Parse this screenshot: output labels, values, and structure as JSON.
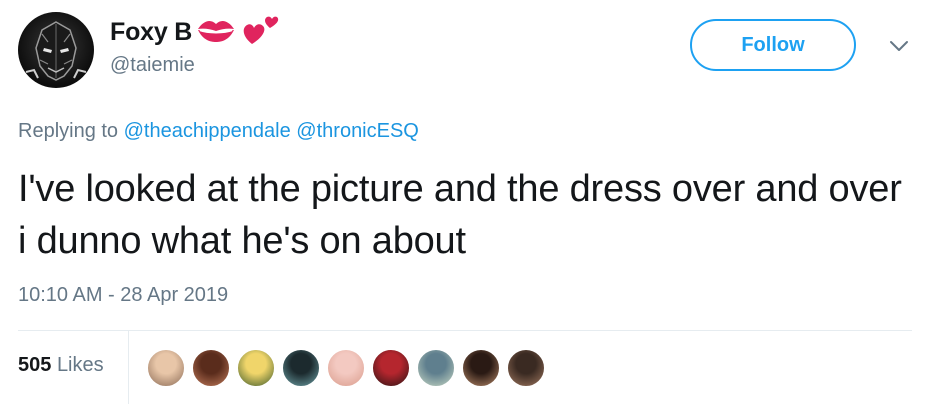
{
  "user": {
    "display_name": "Foxy B",
    "emoji_icons": [
      "kiss-mark-icon",
      "two-hearts-icon"
    ],
    "username": "@taiemie"
  },
  "follow_label": "Follow",
  "reply": {
    "prefix": "Replying to",
    "mentions": [
      "@theachippendale",
      "@thronicESQ"
    ]
  },
  "tweet_text": "I've looked at the picture and the dress over and over i dunno what he's on about",
  "timestamp": "10:10 AM - 28 Apr 2019",
  "likes": {
    "count": "505",
    "label": "Likes"
  },
  "likers": [
    {
      "name": "liker-avatar-1",
      "colors": [
        "#e8c6a8",
        "#8a6a55"
      ]
    },
    {
      "name": "liker-avatar-2",
      "colors": [
        "#5a2c1c",
        "#c27c5c"
      ]
    },
    {
      "name": "liker-avatar-3",
      "colors": [
        "#f0d56a",
        "#3d5a2a"
      ]
    },
    {
      "name": "liker-avatar-4",
      "colors": [
        "#1c2a2e",
        "#6fa3a8"
      ]
    },
    {
      "name": "liker-avatar-5",
      "colors": [
        "#f3c9c1",
        "#d99b8b"
      ]
    },
    {
      "name": "liker-avatar-6",
      "colors": [
        "#b5262e",
        "#2a1414"
      ]
    },
    {
      "name": "liker-avatar-7",
      "colors": [
        "#5f7f8e",
        "#c8d8c4"
      ]
    },
    {
      "name": "liker-avatar-8",
      "colors": [
        "#2a1a14",
        "#b88a6a"
      ]
    },
    {
      "name": "liker-avatar-9",
      "colors": [
        "#3a2a22",
        "#a07860"
      ]
    }
  ],
  "colors": {
    "accent": "#1da1f2",
    "link": "#1b95e0",
    "secondary_text": "#657786",
    "primary_text": "#14171a",
    "heart": "#e0245e"
  }
}
